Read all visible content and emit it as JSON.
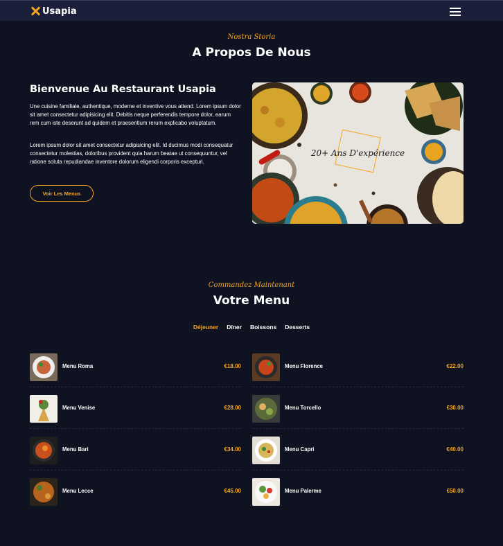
{
  "navbar": {
    "brand": "Usapia",
    "brand_icon": "crossed-utensils-icon",
    "menu_icon": "hamburger-icon"
  },
  "about": {
    "script_label": "Nostra Storia",
    "title": "A Propos De Nous",
    "heading": "Bienvenue Au Restaurant Usapia",
    "paragraph1": "Une cuisine familiale, authentique, moderne et inventive vous attend. Lorem ipsum dolor sit amet consectetur adipisicing elit. Debitis neque perferendis tempore dolor, earum rem cum iste deserunt ad quidem et praesentium rerum explicabo voluptatum.",
    "paragraph2": "Lorem ipsum dolor sit amet consectetur adipisicing elit. Id ducimus modi consequatur consectetur molestias, doloribus provident quia harum beatae ut consequuntur, vel ratione soluta repudiandae inventore dolorum eligendi corporis excepturi.",
    "button": "Voir Les Menus",
    "experience": "20+ Ans D'expérience"
  },
  "menu": {
    "script_label": "Commandez Maintenant",
    "title": "Votre Menu",
    "tabs": [
      "Déjeuner",
      "Dîner",
      "Boissons",
      "Desserts"
    ],
    "active_tab": "Déjeuner",
    "items": [
      {
        "name": "Menu Roma",
        "price": "€18.00"
      },
      {
        "name": "Menu Florence",
        "price": "€22.00"
      },
      {
        "name": "Menu Venise",
        "price": "€28.00"
      },
      {
        "name": "Menu Torcello",
        "price": "€30.00"
      },
      {
        "name": "Menu Bari",
        "price": "€34.00"
      },
      {
        "name": "Menu Capri",
        "price": "€40.00"
      },
      {
        "name": "Menu Lecce",
        "price": "€45.00"
      },
      {
        "name": "Menu Palerme",
        "price": "€50.00"
      }
    ]
  },
  "colors": {
    "background": "#0f1221",
    "navbar": "#1b1f3a",
    "accent": "#f5a623",
    "text": "#ffffff"
  }
}
